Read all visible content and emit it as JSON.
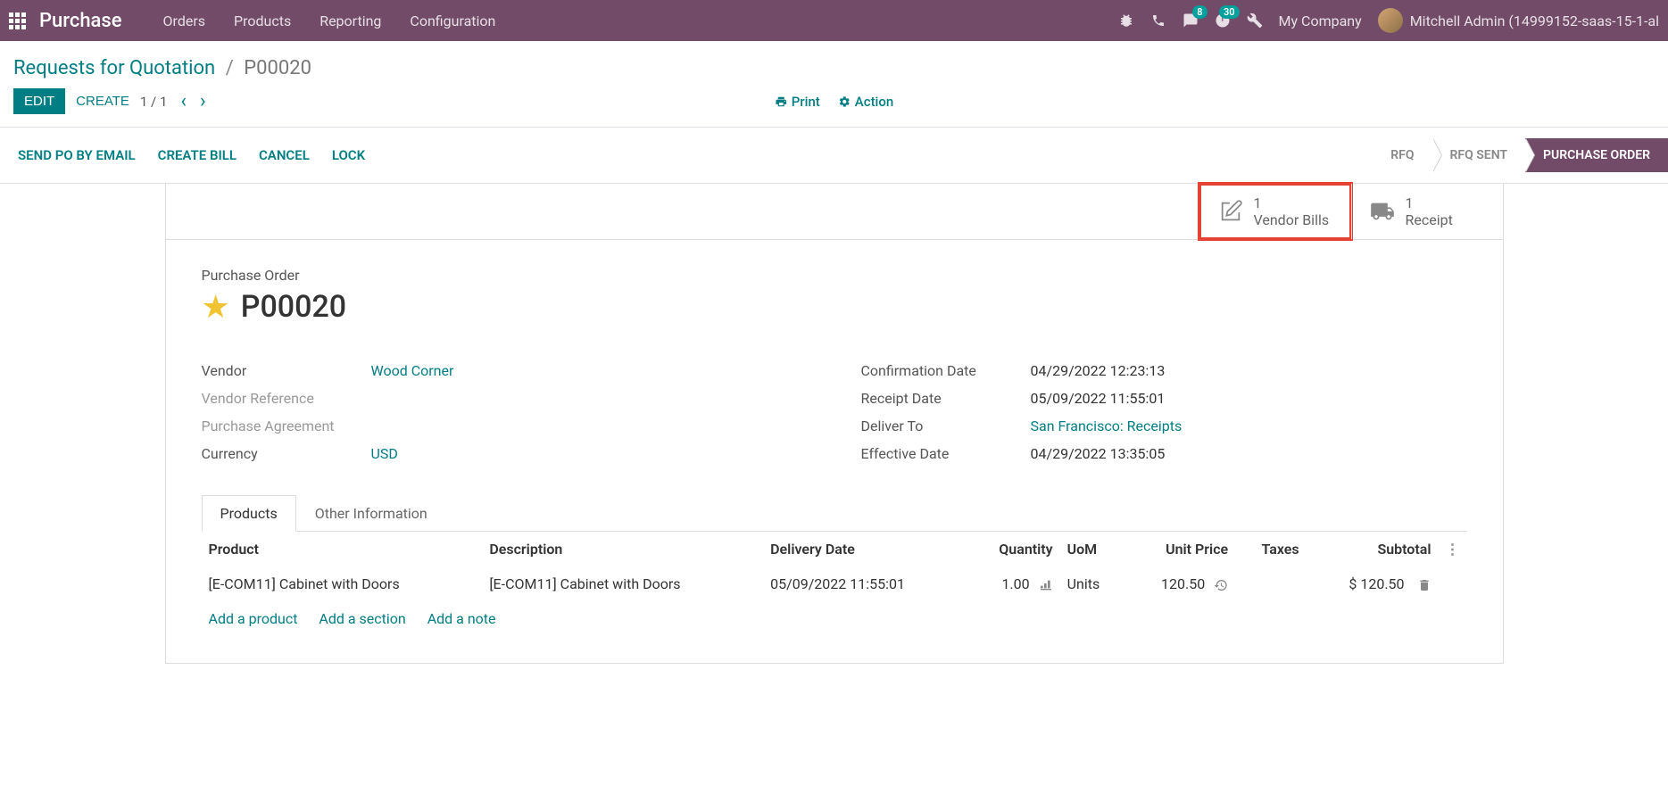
{
  "navbar": {
    "app_name": "Purchase",
    "menu": [
      "Orders",
      "Products",
      "Reporting",
      "Configuration"
    ],
    "badge_messages": "8",
    "badge_activities": "30",
    "company": "My Company",
    "user": "Mitchell Admin (14999152-saas-15-1-al"
  },
  "breadcrumb": {
    "parent": "Requests for Quotation",
    "current": "P00020"
  },
  "control_panel": {
    "edit": "EDIT",
    "create": "CREATE",
    "print": "Print",
    "action": "Action",
    "pager": "1 / 1"
  },
  "statusbar": {
    "send_po": "SEND PO BY EMAIL",
    "create_bill": "CREATE BILL",
    "cancel": "CANCEL",
    "lock": "LOCK",
    "steps": [
      "RFQ",
      "RFQ SENT",
      "PURCHASE ORDER"
    ]
  },
  "stat_buttons": {
    "bills": {
      "count": "1",
      "label": "Vendor Bills"
    },
    "receipt": {
      "count": "1",
      "label": "Receipt"
    }
  },
  "title": {
    "label": "Purchase Order",
    "number": "P00020"
  },
  "fields_left": {
    "vendor_label": "Vendor",
    "vendor_value": "Wood Corner",
    "vendor_ref_label": "Vendor Reference",
    "agreement_label": "Purchase Agreement",
    "currency_label": "Currency",
    "currency_value": "USD"
  },
  "fields_right": {
    "conf_date_label": "Confirmation Date",
    "conf_date_value": "04/29/2022 12:23:13",
    "receipt_date_label": "Receipt Date",
    "receipt_date_value": "05/09/2022 11:55:01",
    "deliver_to_label": "Deliver To",
    "deliver_to_value": "San Francisco: Receipts",
    "eff_date_label": "Effective Date",
    "eff_date_value": "04/29/2022 13:35:05"
  },
  "tabs": {
    "products": "Products",
    "other": "Other Information"
  },
  "table": {
    "headers": {
      "product": "Product",
      "description": "Description",
      "delivery_date": "Delivery Date",
      "quantity": "Quantity",
      "uom": "UoM",
      "unit_price": "Unit Price",
      "taxes": "Taxes",
      "subtotal": "Subtotal"
    },
    "rows": [
      {
        "product": "[E-COM11] Cabinet with Doors",
        "description": "[E-COM11] Cabinet with Doors",
        "delivery_date": "05/09/2022 11:55:01",
        "quantity": "1.00",
        "uom": "Units",
        "unit_price": "120.50",
        "subtotal": "$ 120.50"
      }
    ],
    "add_product": "Add a product",
    "add_section": "Add a section",
    "add_note": "Add a note"
  }
}
